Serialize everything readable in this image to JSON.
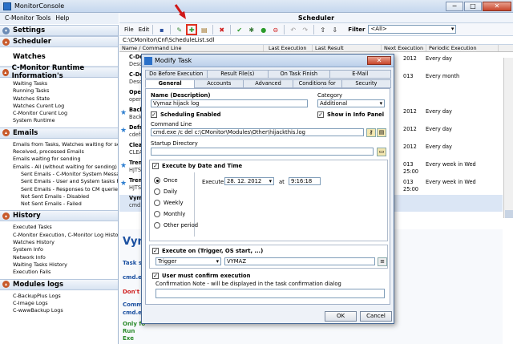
{
  "window": {
    "title": "MonitorConsole",
    "minimize": "─",
    "maximize": "□",
    "close": "✕"
  },
  "menu": {
    "tools": "C-Monitor Tools",
    "help": "Help"
  },
  "sidebar": {
    "settings": "Settings",
    "scheduler": "Scheduler",
    "watches": "Watches",
    "runtime": "C-Monitor Runtime Information's",
    "runtime_items": [
      "Waiting Tasks",
      "Running Tasks",
      "Watches State",
      "Watches Curent Log",
      "C-Monitor Curent Log",
      "System Runtime"
    ],
    "emails": "Emails",
    "email_items": [
      "Emails from Tasks, Watches waiting for sending",
      "Received, processed Emails",
      "Emails waiting for sending",
      "Emails - All (without waiting for sending)"
    ],
    "email_sub": [
      "Sent Emails - C-Monitor System Messages",
      "Sent Emails - User and System tasks Results",
      "Sent Emails - Responses to CM queries",
      "Not Sent Emails - Disabled",
      "Not Sent Emails - Failed"
    ],
    "history": "History",
    "history_items": [
      "Executed Tasks",
      "C-Monitor Execution, C-Monitor Log History",
      "Watches History",
      "System Info",
      "Network Info",
      "Waiting Tasks History",
      "Execution Fails"
    ],
    "modules": "Modules logs",
    "module_items": [
      "C-BackupPlus Logs",
      "C-Image Logs",
      "C-wwwBackup Logs"
    ]
  },
  "main": {
    "title": "Scheduler",
    "file": "File",
    "edit": "Edit",
    "filter_label": "Filter",
    "filter_value": "<All>",
    "path": "C:\\CMonitor\\Cnf\\ScheduleList.sdl",
    "columns": [
      "Name / Command Line",
      "",
      "Last Execution",
      "Last Result",
      "Next Execution",
      "Periodic Execution"
    ],
    "rows": [
      {
        "name": "C-De",
        "desc": "Desc",
        "next": "2012",
        "per": "Every day"
      },
      {
        "name": "C-De",
        "desc": "Desc",
        "next": "013",
        "per": "Every month"
      },
      {
        "name": "Open",
        "desc": "open",
        "next": "",
        "per": ""
      },
      {
        "name": "Back",
        "desc": "Back",
        "next": "2012",
        "per": "Every day"
      },
      {
        "name": "Defra",
        "desc": "cdefr",
        "next": "2012",
        "per": "Every day"
      },
      {
        "name": "Clea",
        "desc": "CLEA",
        "next": "2012",
        "per": "Every day"
      },
      {
        "name": "Tren",
        "desc": "HJTS",
        "next": "013",
        "next2": "25:00",
        "per": "Every week in Wed"
      },
      {
        "name": "Tren",
        "desc": "HJTS",
        "next": "013",
        "next2": "25:00",
        "per": "Every week in Wed"
      },
      {
        "name": "Vym",
        "desc": "cmd.",
        "next": "",
        "per": ""
      }
    ],
    "detail": {
      "title": "Vym",
      "lines": [
        "Task s",
        "cmd.ex",
        "Don't e",
        "Comm",
        "cmd.e",
        "Only fo",
        "Run",
        "Exe"
      ]
    }
  },
  "dialog": {
    "title": "Modify Task",
    "tabs_row1": [
      "Do Before Execution",
      "Result File(s)",
      "On Task Finish",
      "E-Mail"
    ],
    "tabs_row2": [
      "General",
      "Accounts",
      "Advanced",
      "Conditions for Execution",
      "Security"
    ],
    "name_label": "Name (Description)",
    "name_value": "Vymaz hijack log",
    "category_label": "Category",
    "category_value": "Additional",
    "sched_enabled": "Scheduling Enabled",
    "show_info": "Show in Info Panel",
    "cmd_label": "Command Line",
    "cmd_value": "cmd.exe /c del c:\\CMonitor\\Modules\\Other\\hijackthis.log",
    "startup_label": "Startup Directory",
    "startup_value": "",
    "exec_date": "Execute by Date and Time",
    "radios": [
      "Once",
      "Daily",
      "Weekly",
      "Monthly",
      "Other period"
    ],
    "execute_label": "Execute",
    "date_value": "28. 12. 2012",
    "at_label": "at",
    "time_value": "9:16:18",
    "exec_on": "Execute on (Trigger, OS start, ...)",
    "trigger_value": "Trigger",
    "trigger_name": "VYMAZ",
    "confirm": "User must confirm execution",
    "confirm_note": "Confirmation Note - will be displayed in the task confirmation dialog",
    "ok": "OK",
    "cancel": "Cancel"
  },
  "colors": {
    "accent": "#1a4fa0",
    "highlight": "#e03020",
    "titlebar": "#c5d7ee"
  }
}
